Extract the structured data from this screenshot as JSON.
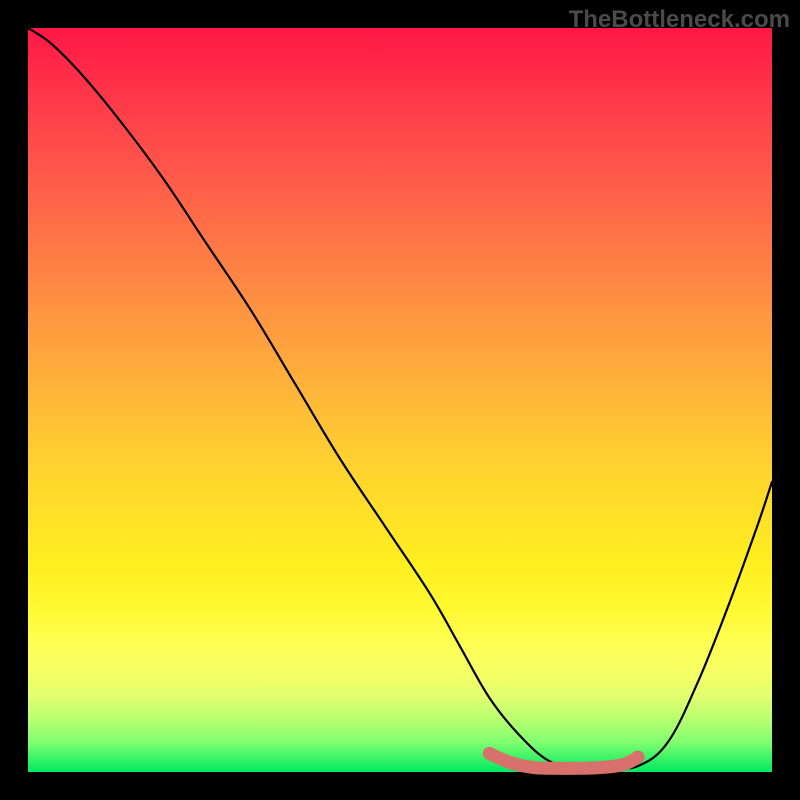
{
  "watermark": "TheBottleneck.com",
  "chart_data": {
    "type": "line",
    "title": "",
    "xlabel": "",
    "ylabel": "",
    "xlim": [
      0,
      100
    ],
    "ylim": [
      0,
      100
    ],
    "series": [
      {
        "name": "main-curve",
        "x": [
          0,
          3,
          7,
          12,
          18,
          24,
          30,
          36,
          42,
          48,
          54,
          58,
          62,
          66,
          70,
          74,
          78,
          82,
          86,
          90,
          94,
          98,
          100
        ],
        "values": [
          100,
          98,
          94,
          88,
          80,
          71,
          62,
          52,
          42,
          33,
          24,
          17,
          10,
          5,
          1.5,
          0.5,
          0.5,
          0.8,
          4,
          12,
          22,
          33,
          39
        ]
      },
      {
        "name": "highlight-segment",
        "x": [
          62,
          65,
          68,
          71,
          74,
          77,
          80,
          82
        ],
        "values": [
          2.5,
          1.2,
          0.6,
          0.5,
          0.5,
          0.6,
          1.0,
          2.0
        ]
      }
    ],
    "colors": {
      "main_curve": "#000000",
      "highlight": "#d8706c",
      "gradient_top": "#ff1744",
      "gradient_mid": "#ffe028",
      "gradient_bottom": "#00e860"
    }
  }
}
